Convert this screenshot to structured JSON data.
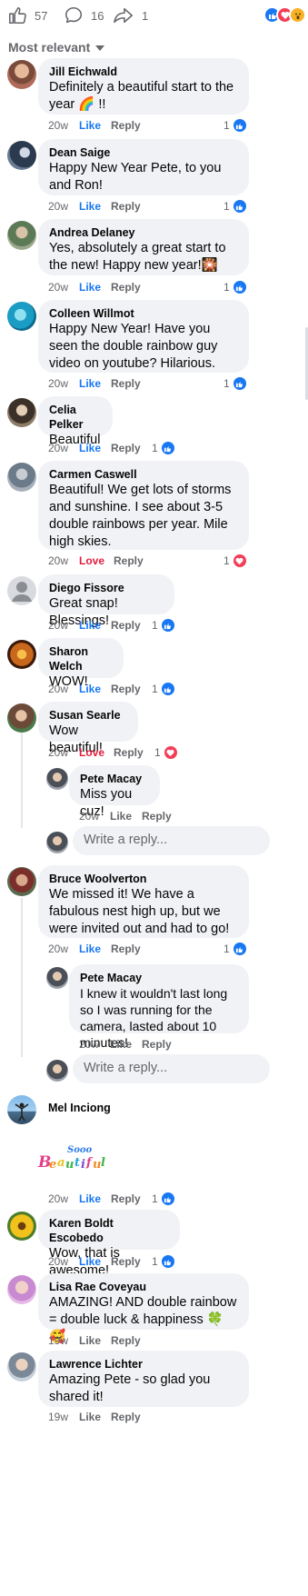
{
  "topbar": {
    "likes": "57",
    "comments": "16",
    "shares": "1",
    "icons": [
      "thumbs-up-outline-icon",
      "comment-bubble-icon",
      "share-arrow-icon"
    ],
    "reactions": [
      "like-reaction-icon",
      "love-reaction-icon",
      "wow-reaction-icon"
    ]
  },
  "sort": {
    "label": "Most relevant"
  },
  "colors": {
    "like": "#1877f2",
    "love": "#f33e58",
    "love_text": "#e41e3f",
    "bubble": "#f0f2f5",
    "muted": "#65676b"
  },
  "comments": [
    {
      "name": "Jill Eichwald",
      "text": "Definitely a beautiful start to the year 🌈 !!",
      "time": "20w",
      "like": "Like",
      "reply": "Reply",
      "count": "1",
      "reaction": "like"
    },
    {
      "name": "Dean Saige",
      "text": "Happy New Year Pete, to you and Ron!",
      "time": "20w",
      "like": "Like",
      "reply": "Reply",
      "count": "1",
      "reaction": "like"
    },
    {
      "name": "Andrea Delaney",
      "text": "Yes, absolutely a great start to the new! Happy new year!🎇",
      "time": "20w",
      "like": "Like",
      "reply": "Reply",
      "count": "1",
      "reaction": "like"
    },
    {
      "name": "Colleen Willmot",
      "text": "Happy New Year! Have you seen the double rainbow guy video on youtube? Hilarious.",
      "time": "20w",
      "like": "Like",
      "reply": "Reply",
      "count": "1",
      "reaction": "like"
    },
    {
      "name": "Celia Pelker",
      "text": "Beautiful",
      "time": "20w",
      "like": "Like",
      "reply": "Reply",
      "count": "1",
      "reaction": "like"
    },
    {
      "name": "Carmen Caswell",
      "text": "Beautiful! We get lots of storms and sunshine. I see about 3-5 double rainbows per year. Mile high skies.",
      "time": "20w",
      "like": "Love",
      "reply": "Reply",
      "count": "1",
      "reaction": "love"
    },
    {
      "name": "Diego Fissore",
      "text": "Great snap! Blessings!",
      "time": "20w",
      "like": "Like",
      "reply": "Reply",
      "count": "1",
      "reaction": "like"
    },
    {
      "name": "Sharon Welch",
      "text": "WOW!",
      "time": "20w",
      "like": "Like",
      "reply": "Reply",
      "count": "1",
      "reaction": "like"
    },
    {
      "name": "Susan Searle",
      "text": "Wow beautiful!",
      "time": "20w",
      "like": "Love",
      "reply": "Reply",
      "count": "1",
      "reaction": "love"
    },
    {
      "name": "Pete Macay",
      "text": "Miss you cuz!",
      "time": "20w",
      "like": "Like",
      "reply": "Reply"
    },
    {
      "name": "Bruce Woolverton",
      "text": "We missed it! We have a fabulous nest high up, but we were invited out and had to go!",
      "time": "20w",
      "like": "Like",
      "reply": "Reply",
      "count": "1",
      "reaction": "like"
    },
    {
      "name": "Pete Macay",
      "text": "I knew it wouldn't last long so I was running for the camera, lasted about 10 minutes!",
      "time": "20w",
      "like": "Like",
      "reply": "Reply"
    },
    {
      "name": "Mel Inciong",
      "sticker": "Sooo Beautiful",
      "time": "20w",
      "like": "Like",
      "reply": "Reply",
      "count": "1",
      "reaction": "like"
    },
    {
      "name": "Karen Boldt Escobedo",
      "text": "Wow, that is awesome!",
      "time": "20w",
      "like": "Like",
      "reply": "Reply",
      "count": "1",
      "reaction": "like"
    },
    {
      "name": "Lisa Rae Coveyau",
      "text": "AMAZING! AND double rainbow = double luck & happiness 🍀🥰",
      "time": "19w",
      "like": "Like",
      "reply": "Reply"
    },
    {
      "name": "Lawrence Lichter",
      "text": "Amazing Pete - so glad you shared it!",
      "time": "19w",
      "like": "Like",
      "reply": "Reply"
    }
  ],
  "reply_box": {
    "placeholder": "Write a reply..."
  }
}
